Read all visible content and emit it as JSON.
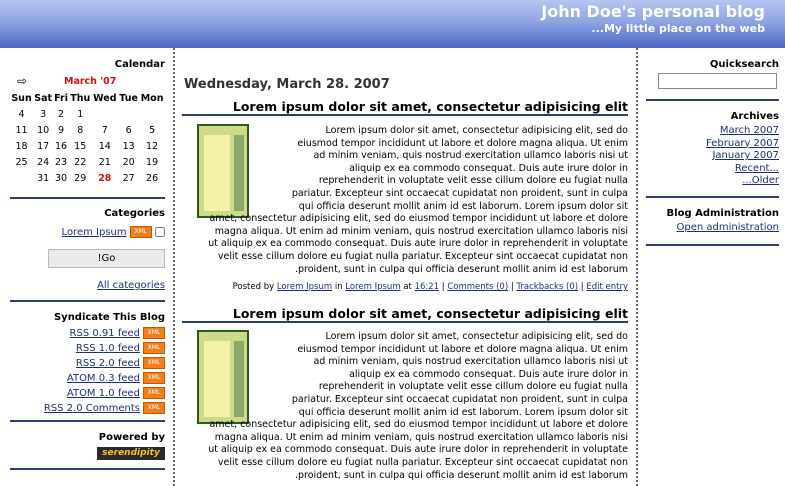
{
  "header": {
    "title": "John Doe's personal blog",
    "subtitle": "...My little place on the web"
  },
  "calendar": {
    "title": "Calendar",
    "prev_icon": "left-arrow-icon",
    "month": "March '07",
    "days": [
      "Sun",
      "Sat",
      "Fri",
      "Thu",
      "Wed",
      "Tue",
      "Mon"
    ],
    "weeks": [
      [
        "4",
        "3",
        "2",
        "1",
        "",
        "",
        ""
      ],
      [
        "11",
        "10",
        "9",
        "8",
        "7",
        "6",
        "5"
      ],
      [
        "18",
        "17",
        "16",
        "15",
        "14",
        "13",
        "12"
      ],
      [
        "25",
        "24",
        "23",
        "22",
        "21",
        "20",
        "19"
      ],
      [
        "",
        "31",
        "30",
        "29",
        "28",
        "27",
        "26"
      ]
    ],
    "highlight": "28"
  },
  "categories": {
    "title": "Categories",
    "item": "Lorem Ipsum",
    "go_label": "!Go",
    "all_label": "All categories"
  },
  "syndicate": {
    "title": "Syndicate This Blog",
    "feeds": [
      "RSS 0.91 feed",
      "RSS 1.0 feed",
      "RSS 2.0 feed",
      "ATOM 0.3 feed",
      "ATOM 1.0 feed",
      "RSS 2.0 Comments"
    ]
  },
  "powered": {
    "title": "Powered by",
    "logo": "serendipity"
  },
  "main": {
    "date": "Wednesday, March 28. 2007",
    "entries": [
      {
        "title": "Lorem ipsum dolor sit amet, consectetur adipisicing elit",
        "lines": [
          "Lorem ipsum dolor sit amet, consectetur adipisicing elit, sed do",
          "eiusmod tempor incididunt ut labore et dolore magna aliqua. Ut enim",
          "ad minim veniam, quis nostrud exercitation ullamco laboris nisi ut",
          "aliquip ex ea commodo consequat. Duis aute irure dolor in",
          "reprehenderit in voluptate velit esse cillum dolore eu fugiat nulla",
          "pariatur. Excepteur sint occaecat cupidatat non proident, sunt in culpa",
          "qui officia deserunt mollit anim id est laborum. Lorem ipsum dolor sit",
          "amet, consectetur adipisicing elit, sed do eiusmod tempor incididunt ut labore et dolore",
          "magna aliqua. Ut enim ad minim veniam, quis nostrud exercitation ullamco laboris nisi",
          "ut aliquip ex ea commodo consequat. Duis aute irure dolor in reprehenderit in voluptate",
          "velit esse cillum dolore eu fugiat nulla pariatur. Excepteur sint occaecat cupidatat non",
          ".proident, sunt in culpa qui officia deserunt mollit anim id est laborum"
        ],
        "footer": {
          "posted_by": "Posted by",
          "author": "Lorem Ipsum",
          "in": "in",
          "category": "Lorem Ipsum",
          "at": "at",
          "time": "16:21",
          "comments": "Comments (0)",
          "trackbacks": "Trackbacks (0)",
          "edit": "Edit entry"
        }
      },
      {
        "title": "Lorem ipsum dolor sit amet, consectetur adipisicing elit",
        "lines": [
          "Lorem ipsum dolor sit amet, consectetur adipisicing elit, sed do",
          "eiusmod tempor incididunt ut labore et dolore magna aliqua. Ut enim",
          "ad minim veniam, quis nostrud exercitation ullamco laboris nisi ut",
          "aliquip ex ea commodo consequat. Duis aute irure dolor in",
          "reprehenderit in voluptate velit esse cillum dolore eu fugiat nulla",
          "pariatur. Excepteur sint occaecat cupidatat non proident, sunt in culpa",
          "qui officia deserunt mollit anim id est laborum. Lorem ipsum dolor sit",
          "amet, consectetur adipisicing elit, sed do eiusmod tempor incididunt ut labore et dolore",
          "magna aliqua. Ut enim ad minim veniam, quis nostrud exercitation ullamco laboris nisi",
          "ut aliquip ex ea commodo consequat. Duis aute irure dolor in reprehenderit in voluptate",
          "velit esse cillum dolore eu fugiat nulla pariatur. Excepteur sint occaecat cupidatat non",
          ".proident, sunt in culpa qui officia deserunt mollit anim id est laborum"
        ]
      }
    ]
  },
  "quicksearch": {
    "title": "Quicksearch",
    "value": ""
  },
  "archives": {
    "title": "Archives",
    "items": [
      "March 2007",
      "February 2007",
      "January 2007",
      "Recent...",
      "...Older"
    ]
  },
  "admin": {
    "title": "Blog Administration",
    "link": "Open administration"
  }
}
